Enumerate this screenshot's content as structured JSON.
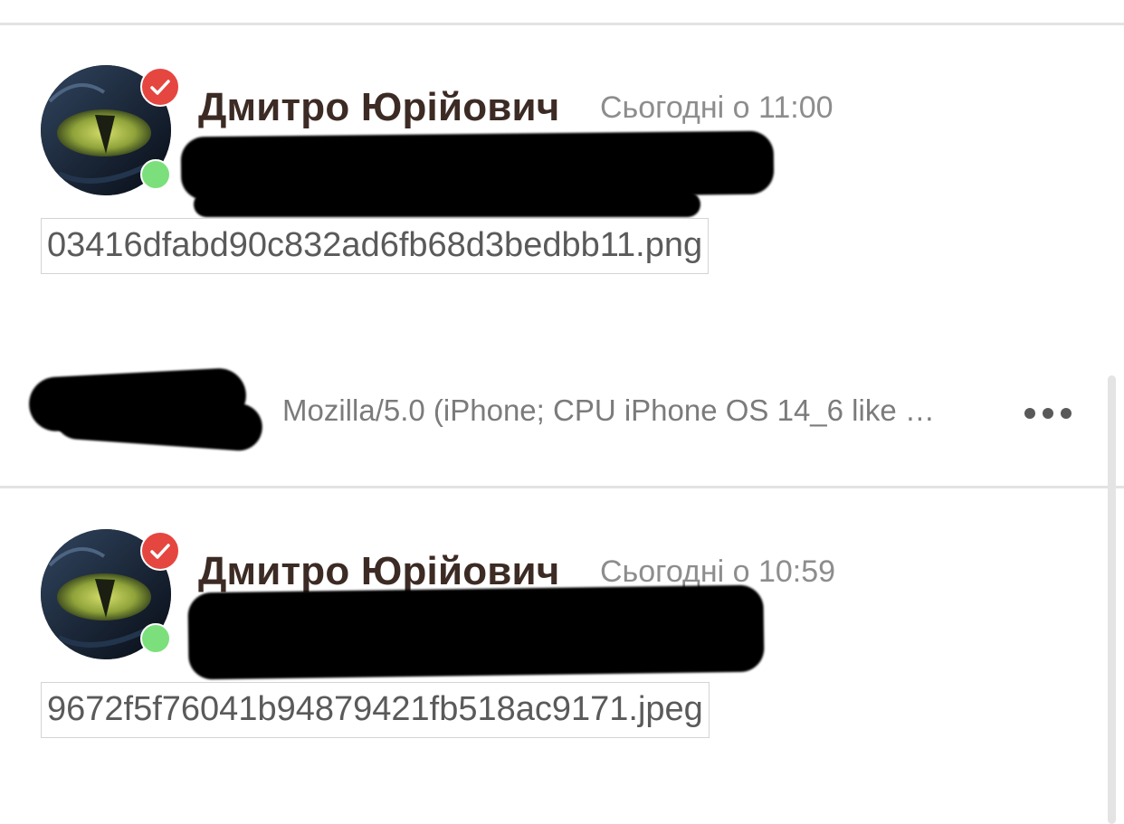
{
  "messages": [
    {
      "author": "Дмитро Юрійович",
      "time": "Сьогодні о 11:00",
      "attachment": "03416dfabd90c832ad6fb68d3bedbb11.png"
    },
    {
      "author": "Дмитро Юрійович",
      "time": "Сьогодні о 10:59",
      "attachment": "9672f5f76041b94879421fb518ac9171.jpeg"
    }
  ],
  "session": {
    "user_agent": "Mozilla/5.0 (iPhone; CPU iPhone OS 14_6 like …",
    "more_icon": "more-horizontal-icon"
  },
  "icons": {
    "verified": "check-icon",
    "online": "online-status-dot"
  },
  "colors": {
    "author": "#3c2b24",
    "timestamp": "#8d8d8d",
    "verified_badge": "#e5463f",
    "online_dot": "#7be07b",
    "attachment_text": "#5a5a5a",
    "divider": "#e3e3e3"
  }
}
